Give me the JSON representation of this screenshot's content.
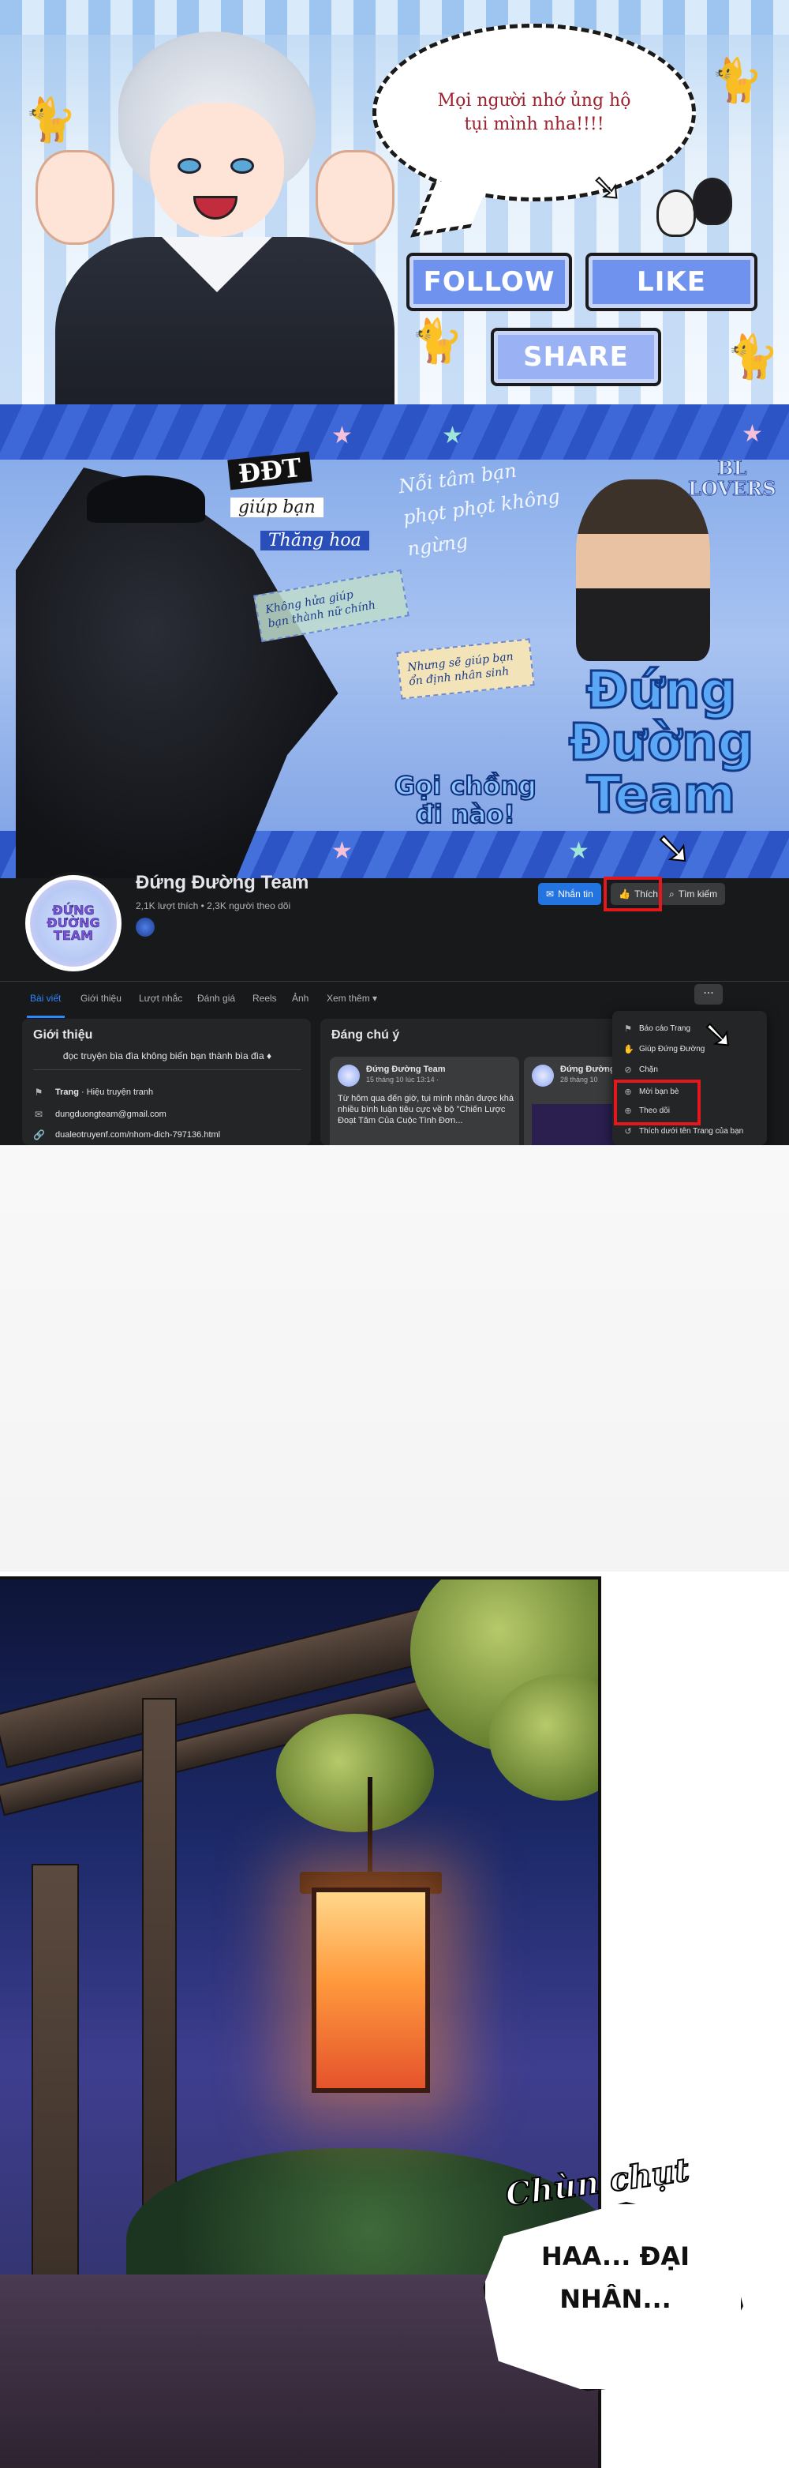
{
  "promo": {
    "bubble_text": "Mọi người nhớ ủng hộ\ntụi mình nha!!!!",
    "follow_label": "FOLLOW",
    "like_label": "LIKE",
    "share_label": "SHARE"
  },
  "cover": {
    "ddt": "ĐĐT",
    "giup_ban": "giúp bạn",
    "thang_hoa": "Thăng hoa",
    "noi_tam": "Nỗi tâm bạn\nphọt phọt không\nngừng",
    "khong_heo": "Không hửa giúp\nbạn thành nữ chính",
    "nhung": "Nhưng sẽ giúp bạn\nổn định nhân sinh",
    "bl_lovers": "BL\nLOVERS",
    "logo": "Đứng\nĐường\nTeam",
    "goi": "Gọi chồng\nđi nào!"
  },
  "page": {
    "name": "Đứng Đường Team",
    "stats": "2,1K lượt thích • 2,3K người theo dõi",
    "avatar_text": "ĐỨNG\nĐƯỜNG\nTEAM",
    "msg_label": "Nhắn tin",
    "like_label": "Thích",
    "search_label": "Tìm kiếm"
  },
  "tabs": [
    "Bài viết",
    "Giới thiệu",
    "Lượt nhắc",
    "Đánh giá",
    "Reels",
    "Ảnh",
    "Xem thêm ▾"
  ],
  "more_label": "···",
  "intro": {
    "heading": "Giới thiệu",
    "text": "đọc truyện bìa đìa không biến bạn thành bìa đìa ♦",
    "rows": [
      {
        "icon": "flag-icon",
        "glyph": "⚑",
        "bold": "Trang",
        "text": " · Hiệu truyện tranh"
      },
      {
        "icon": "mail-icon",
        "glyph": "✉",
        "bold": "",
        "text": "dungduongteam@gmail.com"
      },
      {
        "icon": "link-icon",
        "glyph": "🔗",
        "bold": "",
        "text": "dualeotruyenf.com/nhom-dich-797136.html"
      }
    ]
  },
  "featured": {
    "heading": "Đáng chú ý",
    "posts": [
      {
        "author": "Đứng Đường Team",
        "date": "15 tháng 10 lúc 13:14 ·",
        "text": "Từ hôm qua đến giờ, tụi mình nhận được khá nhiều bình luận tiêu cực về bộ \"Chiến Lược Đoạt Tâm Của Cuộc Tình Đơn..."
      },
      {
        "author": "Đứng Đường",
        "date": "28 tháng 10",
        "text": ""
      }
    ]
  },
  "menu": {
    "items": [
      {
        "icon": "flag-icon",
        "glyph": "⚑",
        "label": "Báo cáo Trang"
      },
      {
        "icon": "hands-icon",
        "glyph": "✋",
        "label": "Giúp Đứng Đường"
      },
      {
        "icon": "block-icon",
        "glyph": "⊘",
        "label": "Chặn"
      },
      {
        "icon": "invite-icon",
        "glyph": "⊕",
        "label": "Mời bạn bè"
      },
      {
        "icon": "follow-icon",
        "glyph": "⊕",
        "label": "Theo dõi"
      },
      {
        "icon": "like-as-page-icon",
        "glyph": "↺",
        "label": "Thích dưới tên Trang của bạn"
      }
    ]
  },
  "comic": {
    "sfx": "Chùn chụt",
    "speech": "HAA... ĐẠI\nNHÂN..."
  }
}
